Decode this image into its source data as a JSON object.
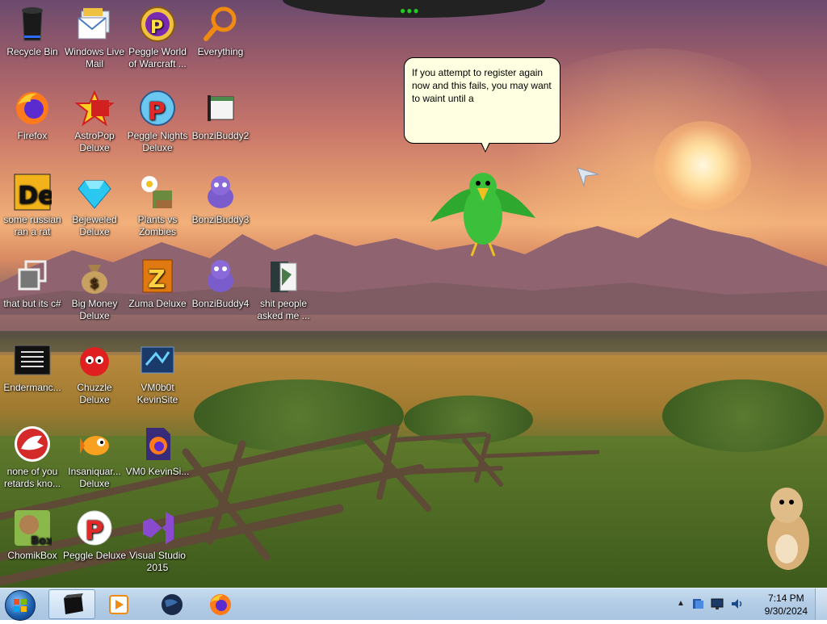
{
  "desktop": {
    "icons": [
      {
        "label": "Recycle Bin",
        "icon": "recycle-bin-icon"
      },
      {
        "label": "Windows Live Mail",
        "icon": "mail-icon"
      },
      {
        "label": "Peggle World of Warcraft ...",
        "icon": "peggle-icon"
      },
      {
        "label": "Everything",
        "icon": "magnifier-icon"
      },
      {
        "label": "Firefox",
        "icon": "firefox-icon"
      },
      {
        "label": "AstroPop Deluxe",
        "icon": "astropop-icon"
      },
      {
        "label": "Peggle Nights Deluxe",
        "icon": "peggle-nights-icon"
      },
      {
        "label": "BonziBuddy2",
        "icon": "window-icon"
      },
      {
        "label": "some russian ran a rat",
        "icon": "de-icon"
      },
      {
        "label": "Bejeweled Deluxe",
        "icon": "gem-icon"
      },
      {
        "label": "Plants vs Zombies",
        "icon": "plants-vs-zombies-icon"
      },
      {
        "label": "BonziBuddy3",
        "icon": "bonzi-icon"
      },
      {
        "label": "that but its c#",
        "icon": "window-stack-icon"
      },
      {
        "label": "Big Money Deluxe",
        "icon": "money-bag-icon"
      },
      {
        "label": "Zuma Deluxe",
        "icon": "zuma-icon"
      },
      {
        "label": "BonziBuddy4",
        "icon": "bonzi-icon"
      },
      {
        "label": "shit people asked me ...",
        "icon": "folder-icon"
      },
      {
        "label": "Endermanc...",
        "icon": "terminal-icon"
      },
      {
        "label": "Chuzzle Deluxe",
        "icon": "chuzzle-icon"
      },
      {
        "label": "VM0b0t KevinSite",
        "icon": "app-icon"
      },
      {
        "label": "none of you retards kno...",
        "icon": "dinosaur-icon"
      },
      {
        "label": "Insaniquar... Deluxe",
        "icon": "fish-icon"
      },
      {
        "label": "VM0 KevinSi...",
        "icon": "firefox-file-icon"
      },
      {
        "label": "ChomikBox",
        "icon": "chomikbox-icon"
      },
      {
        "label": "Peggle Deluxe",
        "icon": "peggle-icon"
      },
      {
        "label": "Visual Studio 2015",
        "icon": "visual-studio-icon"
      }
    ],
    "bubble_text": "If you attempt to register again now and this fails, you may want to waint until a"
  },
  "taskbar": {
    "time": "7:14 PM",
    "date": "9/30/2024",
    "pinned": [
      "terminal-icon",
      "media-player-icon",
      "globe-icon",
      "firefox-icon"
    ],
    "tray": [
      "show-hidden-icons-icon",
      "network-device-icon",
      "monitor-icon",
      "volume-icon"
    ]
  },
  "colors": {
    "taskbar": "#b4cde6",
    "bubble": "#ffffe1",
    "bonzi": "#7a5ccc",
    "parrot": "#2ea82e"
  }
}
